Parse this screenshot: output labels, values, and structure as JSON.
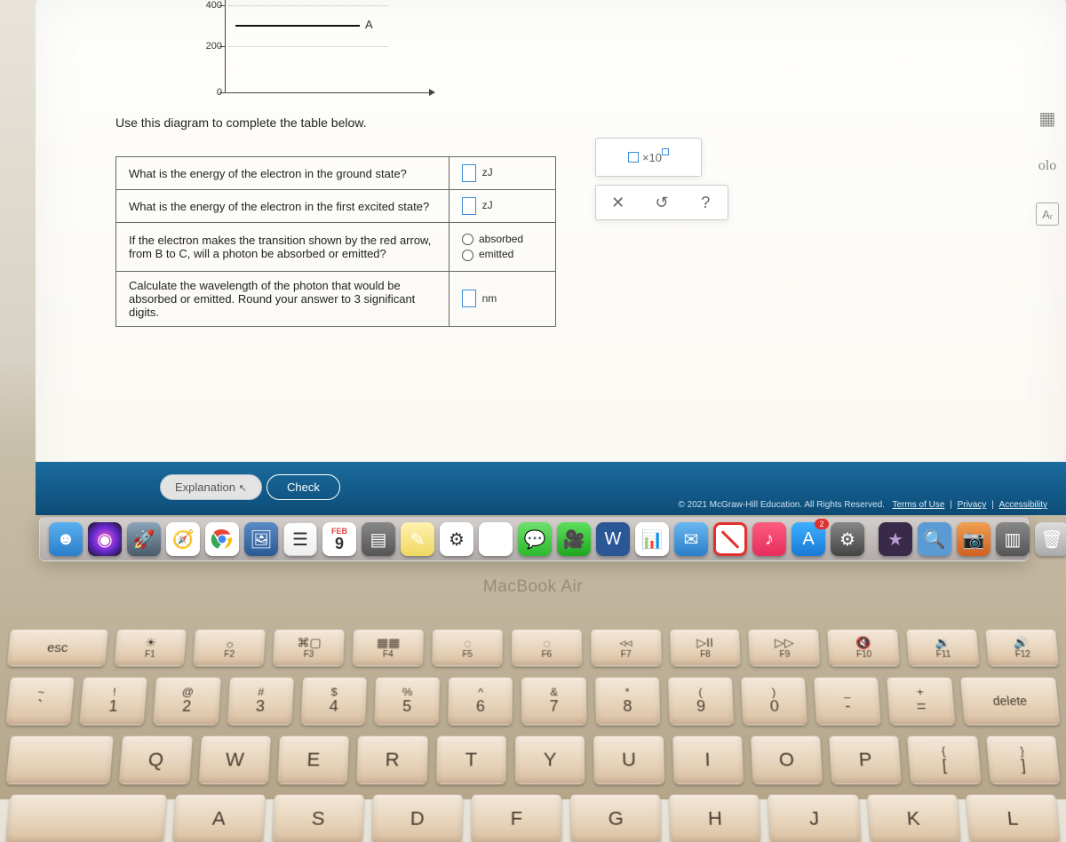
{
  "graph": {
    "ticks": [
      "400",
      "200",
      "0"
    ],
    "line_label": "A"
  },
  "instruction": "Use this diagram to complete the table below.",
  "rows": {
    "r1": {
      "prompt": "What is the energy of the electron in the ground state?",
      "unit": "zJ"
    },
    "r2": {
      "prompt": "What is the energy of the electron in the first excited state?",
      "unit": "zJ"
    },
    "r3": {
      "prompt": "If the electron makes the transition shown by the red arrow, from B to C, will a photon be absorbed or emitted?",
      "opt1": "absorbed",
      "opt2": "emitted"
    },
    "r4": {
      "prompt": "Calculate the wavelength of the photon that would be absorbed or emitted. Round your answer to 3 significant digits.",
      "unit": "nm"
    }
  },
  "scinote_label": "×10",
  "toolbar": {
    "clear": "✕",
    "undo": "↺",
    "help": "?"
  },
  "right_tools": {
    "calc": "▦",
    "periodic": "olo",
    "constants": "Aᵣ"
  },
  "buttons": {
    "explanation": "Explanation",
    "check": "Check"
  },
  "footer": {
    "copyright": "© 2021 McGraw-Hill Education. All Rights Reserved.",
    "terms": "Terms of Use",
    "privacy": "Privacy",
    "accessibility": "Accessibility"
  },
  "calendar": {
    "month": "FEB",
    "day": "9"
  },
  "appstore_badge": "2",
  "macbook": "MacBook Air",
  "keys": {
    "esc": "esc",
    "fn": [
      {
        "sym": "☀",
        "label": "F1"
      },
      {
        "sym": "☼",
        "label": "F2"
      },
      {
        "sym": "⌘▢",
        "label": "F3"
      },
      {
        "sym": "▦▦",
        "label": "F4"
      },
      {
        "sym": "◌",
        "label": "F5"
      },
      {
        "sym": "◌",
        "label": "F6"
      },
      {
        "sym": "◃◃",
        "label": "F7"
      },
      {
        "sym": "▷II",
        "label": "F8"
      },
      {
        "sym": "▷▷",
        "label": "F9"
      },
      {
        "sym": "🔇",
        "label": "F10"
      },
      {
        "sym": "🔉",
        "label": "F11"
      },
      {
        "sym": "🔊",
        "label": "F12"
      }
    ],
    "num_row": [
      {
        "u": "~",
        "l": "`"
      },
      {
        "u": "!",
        "l": "1"
      },
      {
        "u": "@",
        "l": "2"
      },
      {
        "u": "#",
        "l": "3"
      },
      {
        "u": "$",
        "l": "4"
      },
      {
        "u": "%",
        "l": "5"
      },
      {
        "u": "^",
        "l": "6"
      },
      {
        "u": "&",
        "l": "7"
      },
      {
        "u": "*",
        "l": "8"
      },
      {
        "u": "(",
        "l": "9"
      },
      {
        "u": ")",
        "l": "0"
      },
      {
        "u": "_",
        "l": "-"
      },
      {
        "u": "+",
        "l": "="
      }
    ],
    "delete": "delete",
    "row3": [
      "Q",
      "W",
      "E",
      "R",
      "T",
      "Y",
      "U",
      "I",
      "O",
      "P"
    ],
    "row3_brackets": [
      {
        "u": "{",
        "l": "["
      },
      {
        "u": "}",
        "l": "]"
      }
    ],
    "row4": [
      "A",
      "S",
      "D",
      "F",
      "G",
      "H",
      "J",
      "K",
      "L"
    ]
  }
}
